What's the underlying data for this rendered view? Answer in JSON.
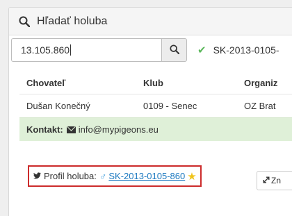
{
  "header": {
    "title": "Hľadať holuba"
  },
  "search": {
    "value": "13.105.860"
  },
  "result": {
    "status_text": "SK-2013-0105-"
  },
  "table": {
    "columns": [
      "Chovateľ",
      "Klub",
      "Organiz"
    ],
    "rows": [
      [
        "Dušan Konečný",
        "0109 - Senec",
        "OZ Brat"
      ]
    ]
  },
  "contact": {
    "label": "Kontakt:",
    "email": "info@mypigeons.eu"
  },
  "profile": {
    "label": "Profil holuba:",
    "link": "SK-2013-0105-860"
  },
  "expand_button": {
    "label": "Zn"
  },
  "colors": {
    "success": "#5cb85c",
    "contact_bg": "#dff0d8",
    "highlight_border": "#cc2b2b",
    "link": "#1c79c0",
    "star": "#f0c419",
    "male_symbol": "#4aa3df"
  },
  "icons": [
    "search-icon",
    "check-icon",
    "envelope-icon",
    "twitter-bird-icon",
    "male-symbol-icon",
    "star-icon",
    "expand-icon"
  ]
}
